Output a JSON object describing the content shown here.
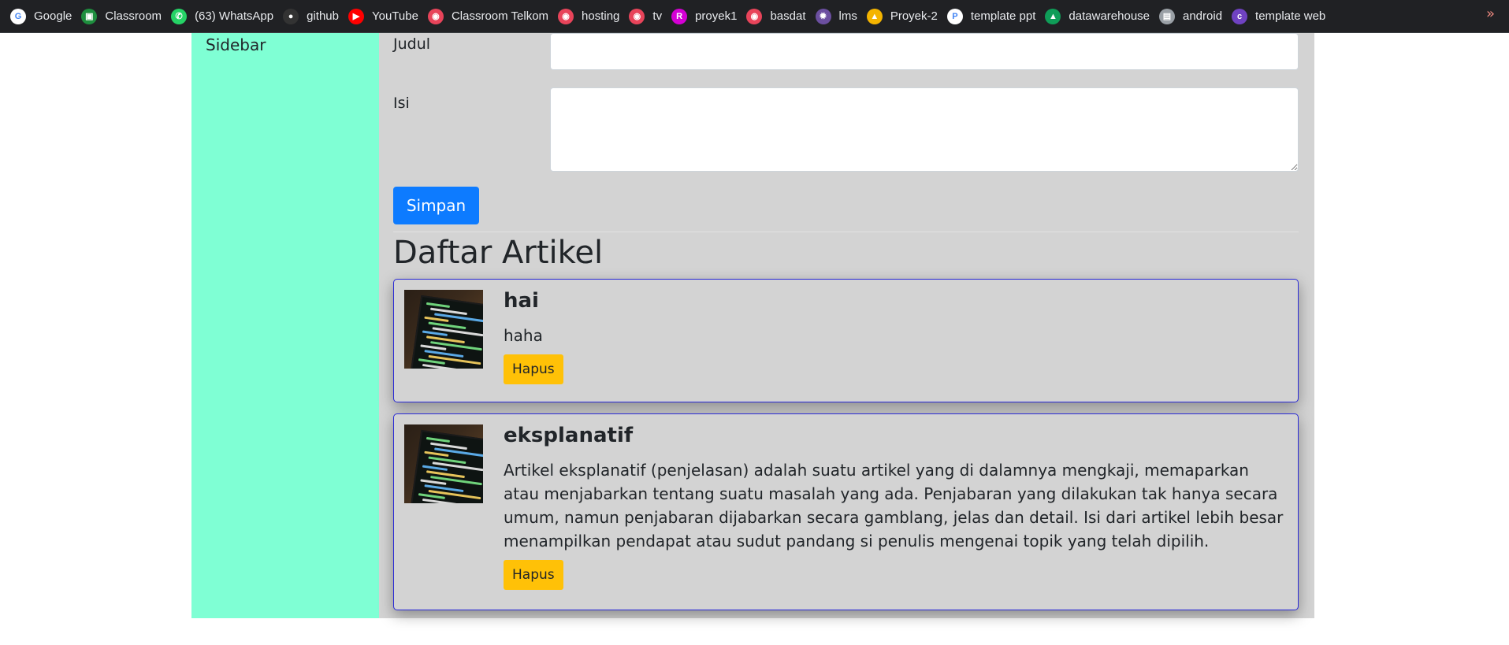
{
  "bookmarks": [
    {
      "label": "Google",
      "icon": "google-icon",
      "color": "#ffffff",
      "glyph": "G"
    },
    {
      "label": "Classroom",
      "icon": "classroom-icon",
      "color": "#1e8e3e",
      "glyph": "▣"
    },
    {
      "label": "(63) WhatsApp",
      "icon": "whatsapp-icon",
      "color": "#25d366",
      "glyph": "✆"
    },
    {
      "label": "github",
      "icon": "github-icon",
      "color": "#333333",
      "glyph": "●"
    },
    {
      "label": "YouTube",
      "icon": "youtube-icon",
      "color": "#ff0000",
      "glyph": "▶"
    },
    {
      "label": "Classroom Telkom",
      "icon": "globe-icon",
      "color": "#e8445a",
      "glyph": "◉"
    },
    {
      "label": "hosting",
      "icon": "globe-icon",
      "color": "#e8445a",
      "glyph": "◉"
    },
    {
      "label": "tv",
      "icon": "globe-icon",
      "color": "#e8445a",
      "glyph": "◉"
    },
    {
      "label": "proyek1",
      "icon": "proyek1-icon",
      "color": "#d400d4",
      "glyph": "R"
    },
    {
      "label": "basdat",
      "icon": "globe-icon",
      "color": "#e8445a",
      "glyph": "◉"
    },
    {
      "label": "lms",
      "icon": "lms-icon",
      "color": "#6b4fa0",
      "glyph": "✹"
    },
    {
      "label": "Proyek-2",
      "icon": "drive-icon",
      "color": "#f4b400",
      "glyph": "▲"
    },
    {
      "label": "template ppt",
      "icon": "ppt-icon",
      "color": "#ffffff",
      "glyph": "P"
    },
    {
      "label": "datawarehouse",
      "icon": "drive-icon",
      "color": "#0f9d58",
      "glyph": "▲"
    },
    {
      "label": "android",
      "icon": "android-icon",
      "color": "#9aa0a6",
      "glyph": "▤"
    },
    {
      "label": "template web",
      "icon": "colorlib-icon",
      "color": "#6f42c1",
      "glyph": "c"
    }
  ],
  "more_label": "»",
  "sidebar": {
    "title": "Sidebar"
  },
  "form": {
    "judul_label": "Judul",
    "judul_value": "",
    "isi_label": "Isi",
    "isi_value": "",
    "submit_label": "Simpan"
  },
  "list": {
    "title": "Daftar Artikel",
    "articles": [
      {
        "title": "hai",
        "content": "haha",
        "delete_label": "Hapus"
      },
      {
        "title": "eksplanatif",
        "content": "Artikel eksplanatif (penjelasan) adalah suatu artikel yang di dalamnya mengkaji, memaparkan atau menjabarkan tentang suatu masalah yang ada. Penjabaran yang dilakukan tak hanya secara umum, namun penjabaran dijabarkan secara gamblang, jelas dan detail. Isi dari artikel lebih besar menampilkan pendapat atau sudut pandang si penulis mengenai topik yang telah dipilih.",
        "delete_label": "Hapus"
      }
    ]
  },
  "colors": {
    "sidebar_bg": "#7fffd4",
    "main_bg": "#d3d3d3",
    "primary": "#0d7bff",
    "warning": "#ffc107",
    "card_border": "#2929d6"
  }
}
